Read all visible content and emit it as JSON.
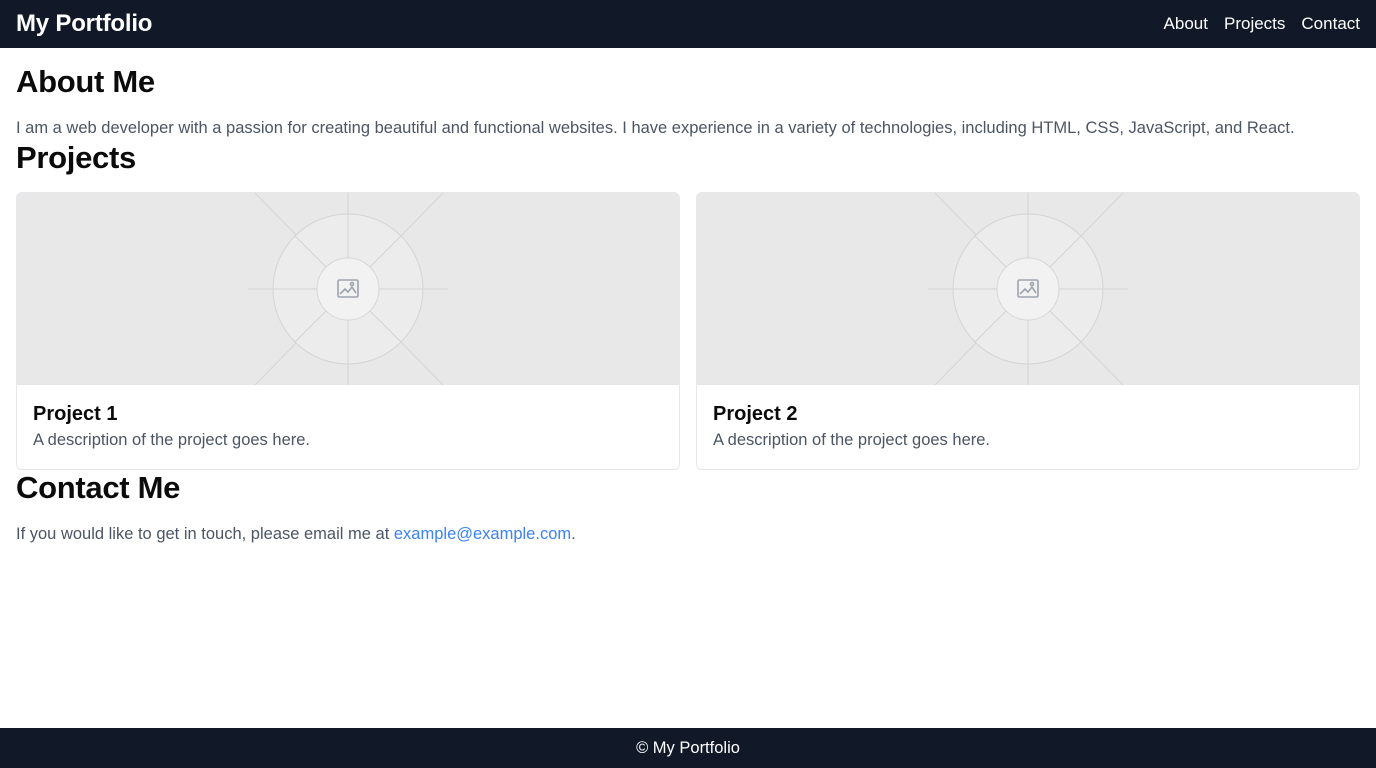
{
  "header": {
    "brand": "My Portfolio",
    "nav": [
      {
        "label": "About"
      },
      {
        "label": "Projects"
      },
      {
        "label": "Contact"
      }
    ]
  },
  "about": {
    "title": "About Me",
    "text": "I am a web developer with a passion for creating beautiful and functional websites. I have experience in a variety of technologies, including HTML, CSS, JavaScript, and React."
  },
  "projects": {
    "title": "Projects",
    "items": [
      {
        "title": "Project 1",
        "description": "A description of the project goes here.",
        "image_icon": "image-placeholder-icon"
      },
      {
        "title": "Project 2",
        "description": "A description of the project goes here.",
        "image_icon": "image-placeholder-icon"
      }
    ]
  },
  "contact": {
    "title": "Contact Me",
    "text_before": "If you would like to get in touch, please email me at ",
    "email": "example@example.com",
    "text_after": "."
  },
  "footer": {
    "text": "© My Portfolio"
  },
  "colors": {
    "header_bg": "#111827",
    "footer_bg": "#111827",
    "link": "#3b82f6",
    "body_text": "#4b5563",
    "placeholder_bg": "#e8e8e8"
  }
}
